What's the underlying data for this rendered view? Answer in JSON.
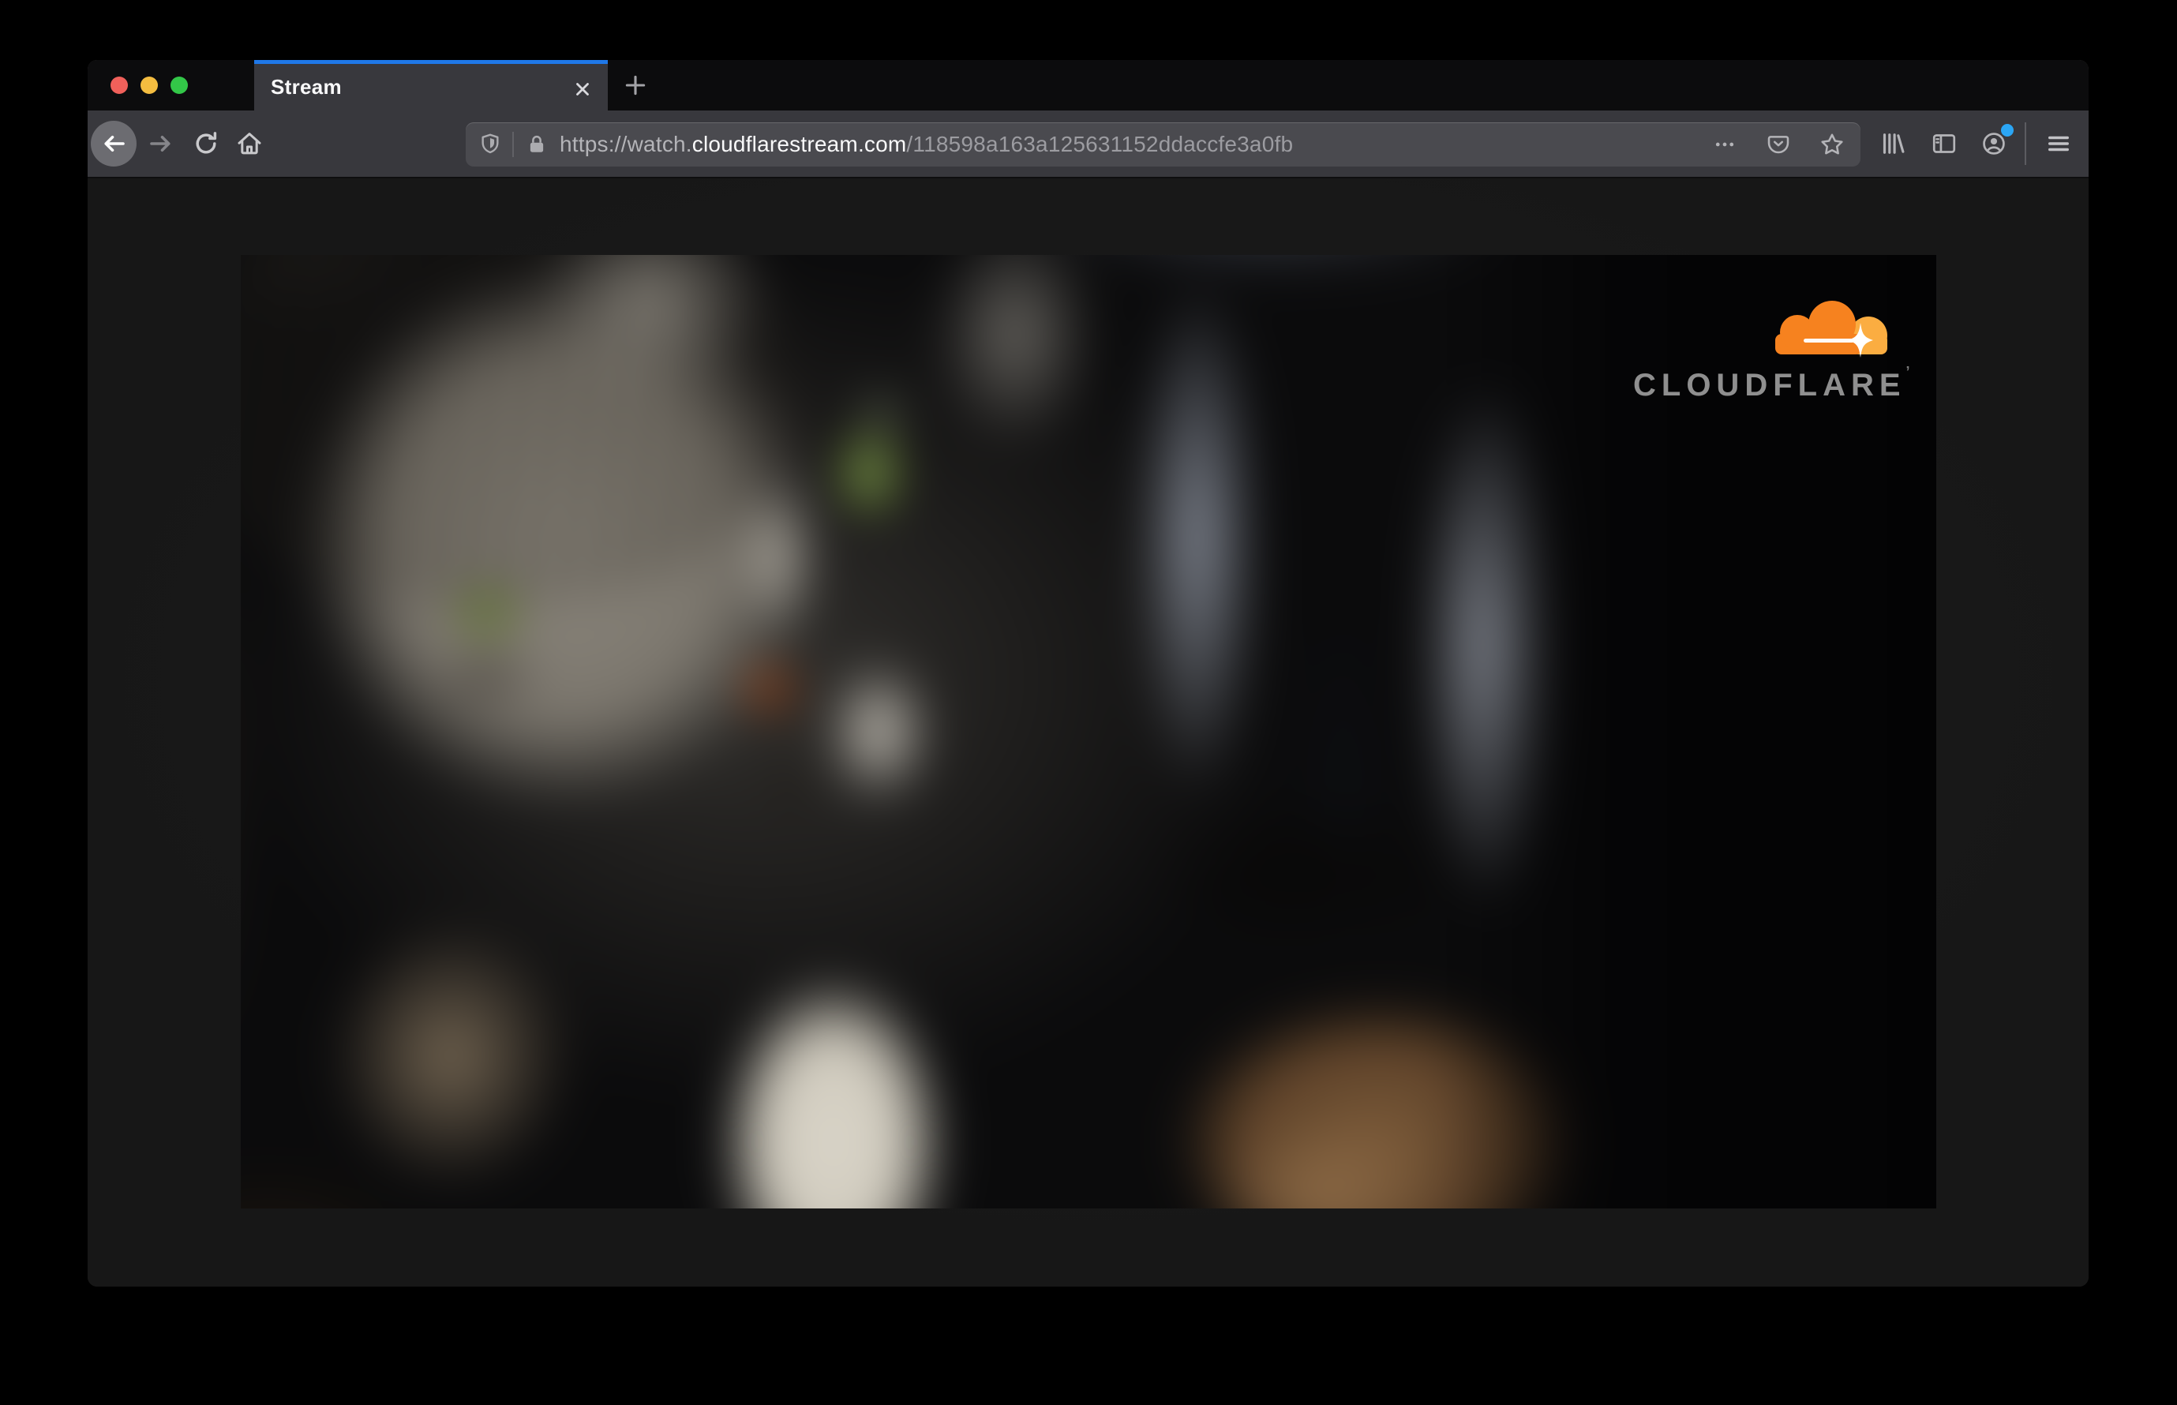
{
  "window": {
    "controls": [
      {
        "name": "close",
        "color": "#f0605a"
      },
      {
        "name": "minimize",
        "color": "#f4bd40"
      },
      {
        "name": "zoom",
        "color": "#33c748"
      }
    ]
  },
  "tab_bar": {
    "active_tab": {
      "title": "Stream"
    },
    "accent_color": "#1f78e8"
  },
  "toolbar": {
    "icons": [
      "back-arrow",
      "forward-arrow",
      "reload",
      "home",
      "library",
      "sidebar",
      "account",
      "hamburger-menu"
    ],
    "account_badge_color": "#2ba6f5"
  },
  "url_bar": {
    "icons_left": [
      "tracking-protection-shield",
      "padlock"
    ],
    "prefix": "https://watch.",
    "domain": "cloudflarestream.com",
    "path": "/118598a163a125631152ddaccfe3a0fb",
    "icons_right": [
      "ellipsis",
      "pocket",
      "bookmark-star"
    ]
  },
  "player": {
    "brand_text": "CLOUDFLARE",
    "brand_mark": "’",
    "logo_orange": "#f6821f",
    "logo_light_orange": "#fbad41",
    "content_description": "blurry close-up of a gray tabby cat with green eyes"
  },
  "colors": {
    "titlebar": "#0c0c0d",
    "toolbar": "#38383d",
    "urlbar_field": "#4a4a4f",
    "content_bg": "#191919"
  }
}
